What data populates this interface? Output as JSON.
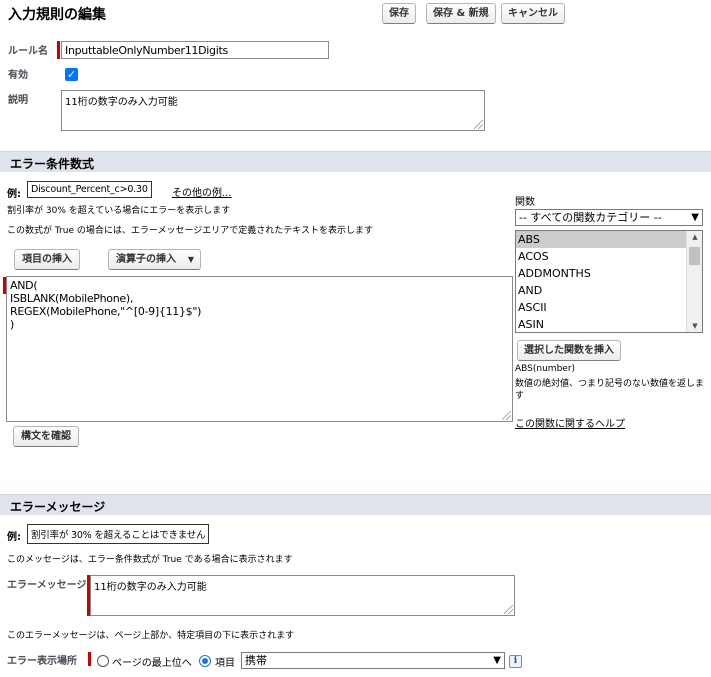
{
  "header": {
    "title": "入力規則の編集",
    "save_label": "保存",
    "save_new_label": "保存 & 新規",
    "cancel_label": "キャンセル"
  },
  "rule": {
    "name_label": "ルール名",
    "name_value": "InputtableOnlyNumber11Digits",
    "active_label": "有効",
    "active_checked": true,
    "description_label": "説明",
    "description_value": "11桁の数字のみ入力可能"
  },
  "condition_section": {
    "title": "エラー条件数式",
    "example_label": "例:",
    "example_value": "Discount_Percent_c>0.30",
    "more_examples_link": "その他の例...",
    "example_desc": "割引率が 30% を超えている場合にエラーを表示します",
    "true_desc": "この数式が True の場合には、エラーメッセージエリアで定義されたテキストを表示します",
    "insert_field_label": "項目の挿入",
    "insert_operator_label": "演算子の挿入",
    "formula_lines": [
      "AND(",
      "ISBLANK(MobilePhone),",
      "REGEX(MobilePhone,\"^[0-9]{11}$\")",
      ")"
    ],
    "check_syntax_label": "構文を確認"
  },
  "functions_panel": {
    "label": "関数",
    "category_selected": "-- すべての関数カテゴリー --",
    "items": [
      "ABS",
      "ACOS",
      "ADDMONTHS",
      "AND",
      "ASCII",
      "ASIN"
    ],
    "selected_item": "ABS",
    "insert_button": "選択した関数を挿入",
    "signature": "ABS(number)",
    "description": "数値の絶対値、つまり記号のない数値を返します",
    "help_link": "この関数に関するヘルプ"
  },
  "message_section": {
    "title": "エラーメッセージ",
    "example_label": "例:",
    "example_value": "割引率が 30% を超えることはできません",
    "true_desc": "このメッセージは、エラー条件数式が True である場合に表示されます",
    "message_label": "エラーメッセージ",
    "message_value": "11桁の数字のみ入力可能",
    "location_desc": "このエラーメッセージは、ページ上部か、特定項目の下に表示されます",
    "location_label": "エラー表示場所",
    "option_top": "ページの最上位へ",
    "option_field": "項目",
    "option_field_selected": true,
    "field_selected": "携帯",
    "info_icon": "i"
  }
}
